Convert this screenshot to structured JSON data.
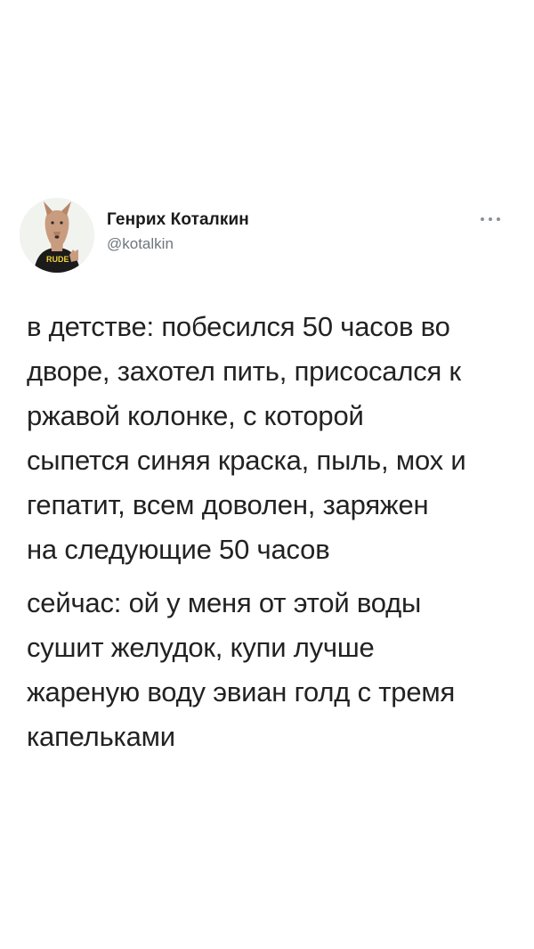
{
  "author": {
    "display_name": "Генрих Коталкин",
    "handle": "@kotalkin",
    "avatar_shirt_text": "RUDE"
  },
  "tweet": {
    "paragraphs": [
      "в детстве: побесился 50 часов во\nдворе, захотел пить, присосался к\nржавой колонке, с которой\nсыпется синяя краска, пыль, мох и\nгепатит, всем доволен, заряжен\nна следующие 50 часов",
      "сейчас: ой у меня от этой воды\nсушит желудок, купи лучше\nжареную воду эвиан голд с тремя\nкапельками"
    ]
  },
  "icons": {
    "more": "more-dots-icon"
  },
  "colors": {
    "text": "#222222",
    "handle": "#6e767d",
    "background": "#ffffff"
  }
}
